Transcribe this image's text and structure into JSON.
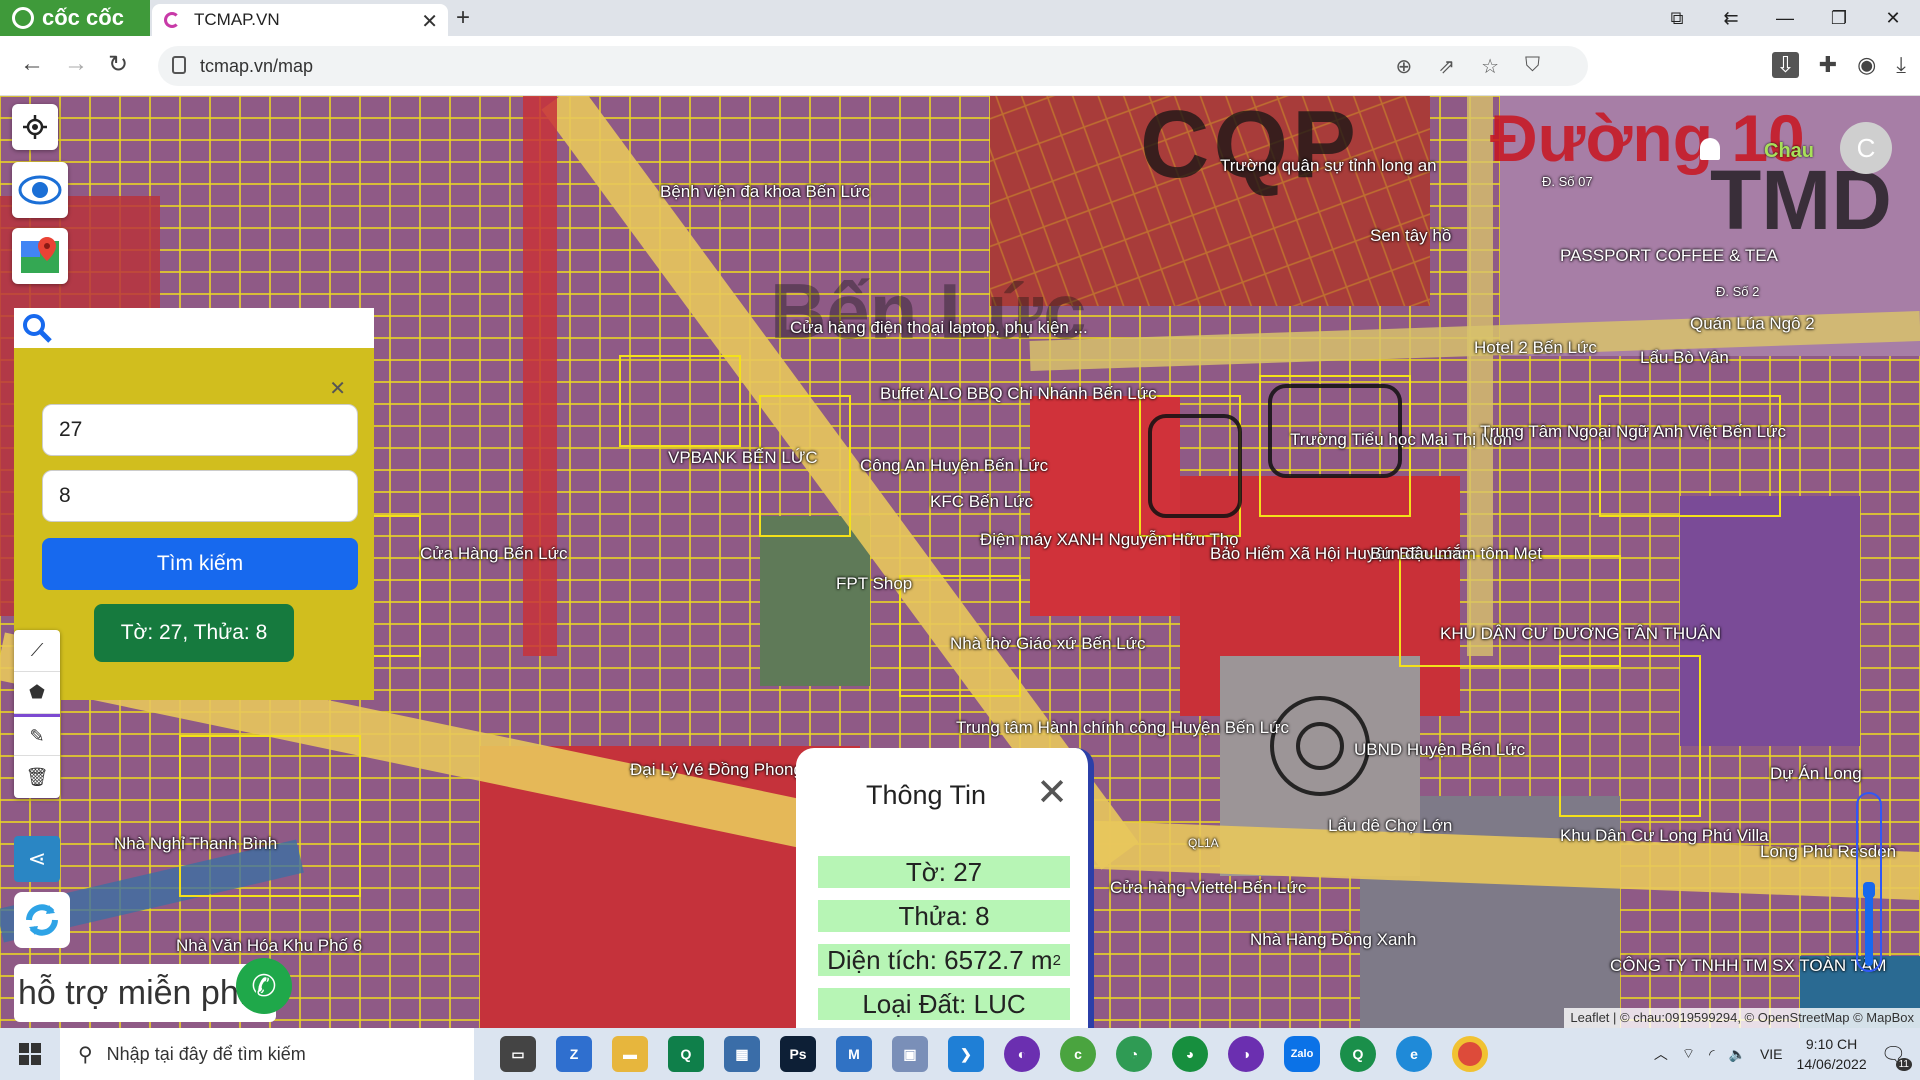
{
  "browser": {
    "brand": "cốc cốc",
    "tab_title": "TCMAP.VN",
    "url": "tcmap.vn/map"
  },
  "map": {
    "labels": [
      {
        "text": "Bệnh viện đa khoa Bến Lức"
      },
      {
        "text": "CQP"
      },
      {
        "text": "Trường quân sự tỉnh long an"
      },
      {
        "text": "Sen tây hồ"
      },
      {
        "text": "PASSPORT COFFEE & TEA"
      },
      {
        "text": "Quán Lúa Ngô 2"
      },
      {
        "text": "Bến Lức"
      },
      {
        "text": "Cửa hàng điện thoại laptop, phụ kiện ..."
      },
      {
        "text": "Buffet ALO BBQ Chi Nhánh Bến Lức"
      },
      {
        "text": "Trường Tiểu học Mai Thị Non"
      },
      {
        "text": "Trung Tâm Ngoại Ngữ Anh Việt Bến Lức"
      },
      {
        "text": "VPBANK BẾN LỨC"
      },
      {
        "text": "Công An Huyện Bến Lức"
      },
      {
        "text": "KFC Bến Lức"
      },
      {
        "text": "Điện máy XANH Nguyễn Hữu Thọ"
      },
      {
        "text": "Bảo Hiểm Xã Hội Huyện Bến Lức"
      },
      {
        "text": "Bún đậu mắm tôm Mẹt"
      },
      {
        "text": "FPT Shop"
      },
      {
        "text": "KHU DÂN CƯ DƯƠNG TÂN THUẬN"
      },
      {
        "text": "Nhà thờ Giáo xứ Bến Lức"
      },
      {
        "text": "Trung tâm Hành chính công Huyện Bến Lức"
      },
      {
        "text": "UBND Huyện Bến Lức"
      },
      {
        "text": "Lẩu dê Chợ Lớn"
      },
      {
        "text": "Khu Dân Cư Long Phú Villa"
      },
      {
        "text": "Cửa hàng Viettel Bến Lức"
      },
      {
        "text": "Nhà Hàng Đồng Xanh"
      },
      {
        "text": "CÔNG TY TNHH TM SX TOÀN TÂM"
      },
      {
        "text": "Đại Lý Vé Đồng Phong"
      },
      {
        "text": "Nhà Nghỉ Thanh Bình"
      },
      {
        "text": "Nhà Văn Hóa Khu Phố 6"
      },
      {
        "text": "Cửa Hàng Bến Lức"
      },
      {
        "text": "Hotel 2 Bến Lức"
      },
      {
        "text": "Lẩu Bò Vân"
      },
      {
        "text": "Dự Án Long"
      },
      {
        "text": "Long Phú Resden"
      },
      {
        "text": "TMD"
      },
      {
        "text": "Đường 10"
      },
      {
        "text": "Đ. Số 07"
      },
      {
        "text": "Đ. Số 2"
      },
      {
        "text": "QL1A"
      }
    ]
  },
  "search_panel": {
    "field_to": "27",
    "field_thua": "8",
    "search_button": "Tìm kiếm",
    "result_tag": "Tờ: 27, Thửa: 8"
  },
  "support_text": "hỗ trợ miễn phí",
  "user": {
    "name": "Chau",
    "avatar_letter": "C"
  },
  "info_popup": {
    "title": "Thông Tin",
    "to": "Tờ: 27",
    "thua": "Thửa: 8",
    "dien_tich_prefix": "Diện tích: 6572.7 m",
    "dien_tich_sup": "2",
    "loai_dat": "Loại Đất: LUC"
  },
  "zoom_level": 0.45,
  "attribution": "Leaflet | © chau:0919599294, © OpenStreetMap © MapBox",
  "taskbar": {
    "search_placeholder": "Nhập tại đây để tìm kiếm",
    "language": "VIE",
    "time": "9:10 CH",
    "date": "14/06/2022",
    "notifications": "11"
  },
  "colors": {
    "panel": "#d1be1e",
    "search_button": "#1769ee",
    "result_tag": "#167a3e",
    "info_row": "#b7f5b5",
    "brand": "#3f9a3a"
  }
}
